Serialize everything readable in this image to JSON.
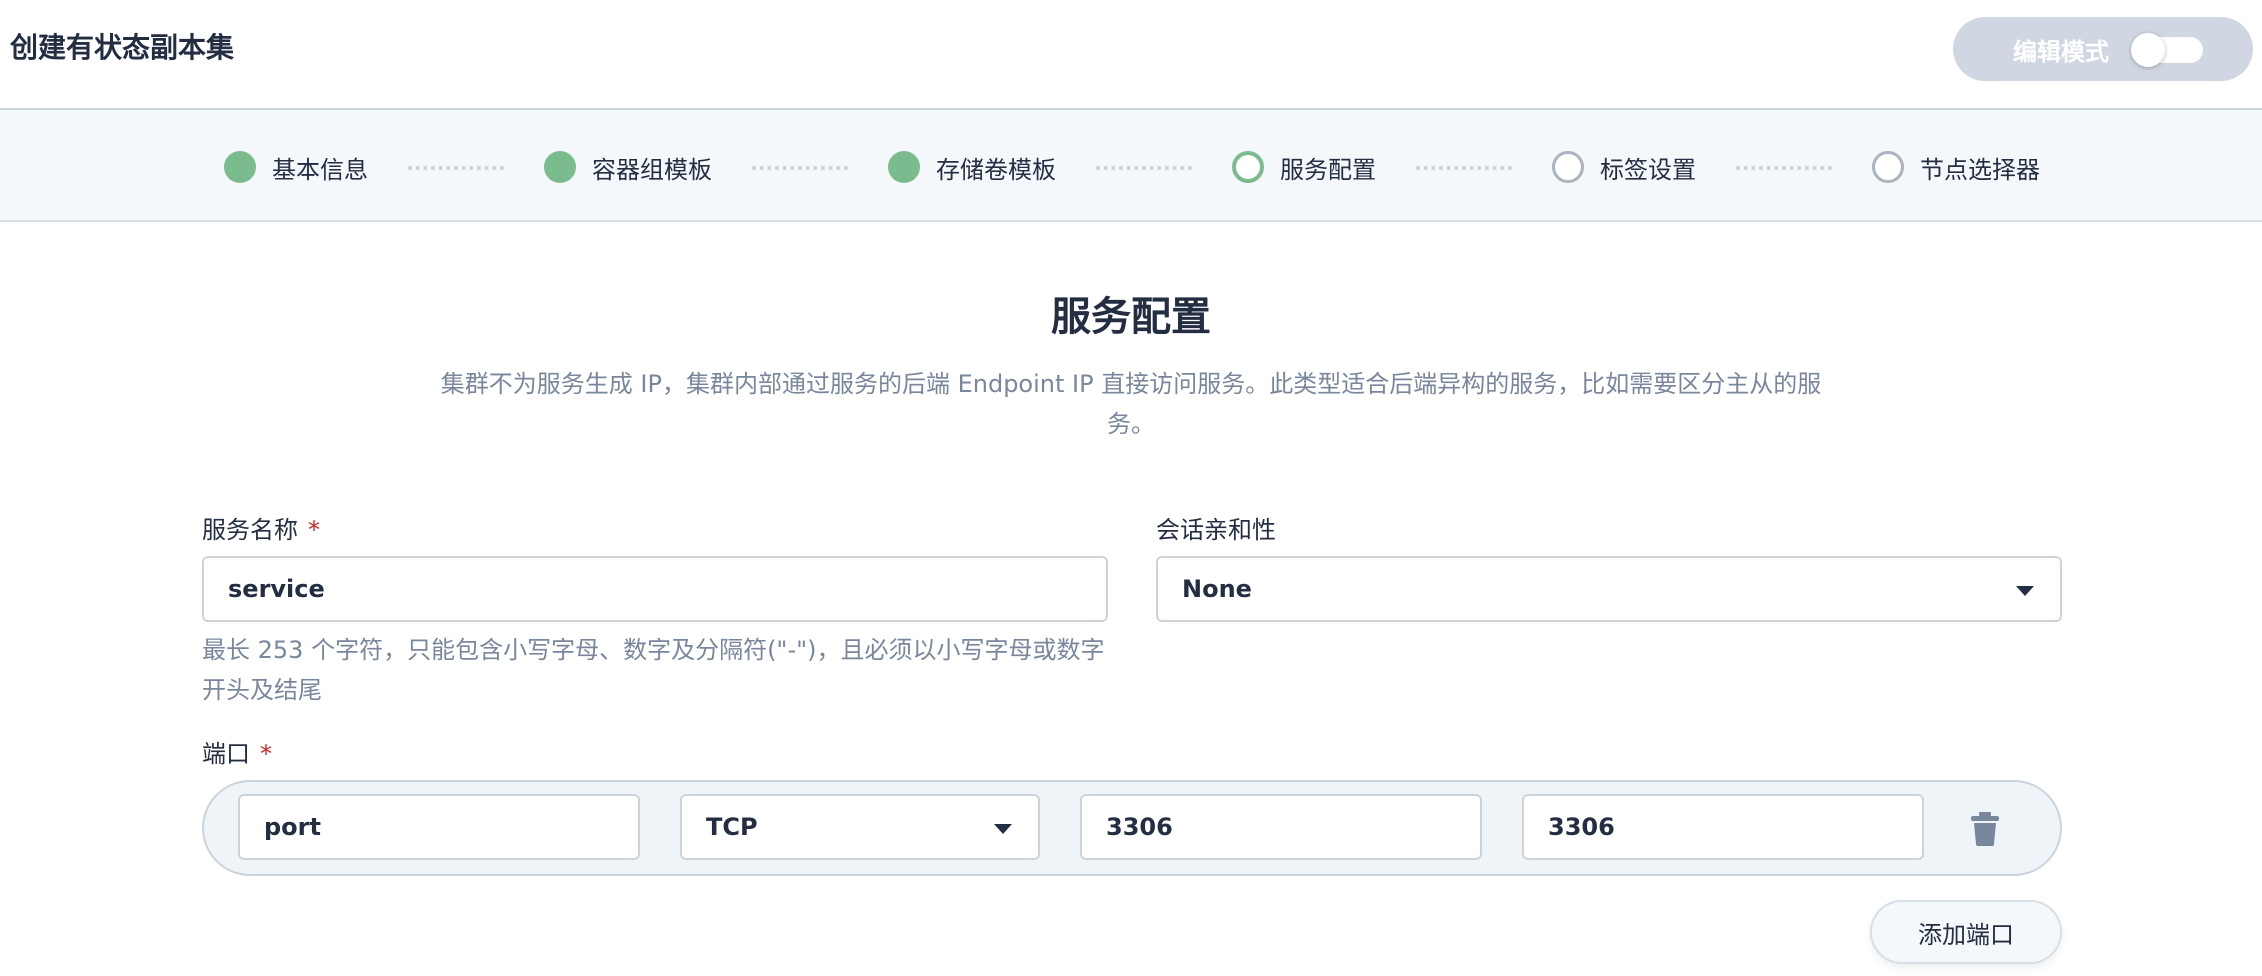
{
  "header": {
    "title": "创建有状态副本集",
    "edit_mode_label": "编辑模式",
    "edit_mode_on": false
  },
  "steps": [
    {
      "label": "基本信息",
      "status": "done"
    },
    {
      "label": "容器组模板",
      "status": "done"
    },
    {
      "label": "存储卷模板",
      "status": "done"
    },
    {
      "label": "服务配置",
      "status": "current"
    },
    {
      "label": "标签设置",
      "status": "todo"
    },
    {
      "label": "节点选择器",
      "status": "todo"
    }
  ],
  "main": {
    "title": "服务配置",
    "description": "集群不为服务生成 IP，集群内部通过服务的后端 Endpoint IP 直接访问服务。此类型适合后端异构的服务，比如需要区分主从的服务。",
    "service_name": {
      "label": "服务名称",
      "required_mark": "*",
      "value": "service",
      "hint": "最长 253 个字符，只能包含小写字母、数字及分隔符(\"-\")，且必须以小写字母或数字开头及结尾"
    },
    "session_affinity": {
      "label": "会话亲和性",
      "value": "None"
    },
    "ports": {
      "label": "端口",
      "required_mark": "*",
      "rows": [
        {
          "name": "port",
          "protocol": "TCP",
          "container_port": "3306",
          "service_port": "3306"
        }
      ]
    },
    "add_port_label": "添加端口"
  },
  "colors": {
    "done": "#7bbc8e",
    "todo": "#abb4be",
    "required": "#ca2621",
    "muted_text": "#79879c",
    "text": "#242e42"
  },
  "icons": {
    "delete": "trash-icon",
    "dropdown": "chevron-down-icon"
  }
}
